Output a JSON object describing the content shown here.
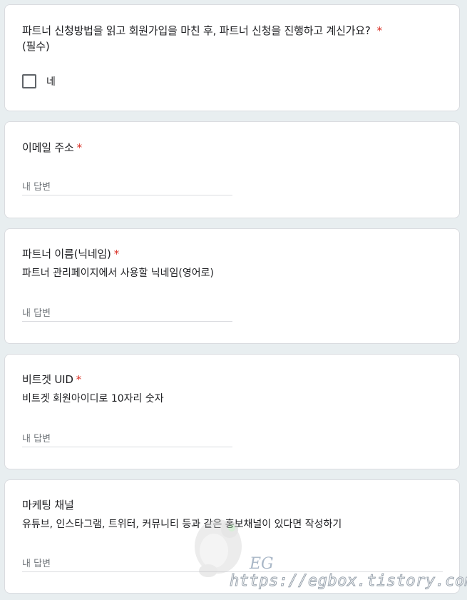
{
  "required_mark": "*",
  "questions": [
    {
      "title_line1": "파트너 신청방법을 읽고 회원가입을 마친 후, 파트너 신청을 진행하고 계신가요?",
      "title_line2": "(필수)",
      "checkbox_label": "네"
    },
    {
      "title": "이메일 주소",
      "placeholder": "내 답변"
    },
    {
      "title": "파트너 이름(닉네임)",
      "description": "파트너 관리페이지에서 사용할 닉네임(영어로)",
      "placeholder": "내 답변"
    },
    {
      "title": "비트겟 UID",
      "description": "비트겟 회원아이디로 10자리 숫자",
      "placeholder": "내 답변"
    },
    {
      "title": "마케팅 채널",
      "description": "유튜브, 인스타그램, 트위터, 커뮤니티 등과 같은 홍보채널이 있다면 작성하기",
      "placeholder": "내 답변"
    }
  ],
  "watermark": {
    "text": "EG",
    "url": "https://egbox.tistory.com/"
  },
  "colors": {
    "background": "#e8eef0",
    "card": "#ffffff",
    "required": "#d93025",
    "placeholder": "#70757a"
  }
}
